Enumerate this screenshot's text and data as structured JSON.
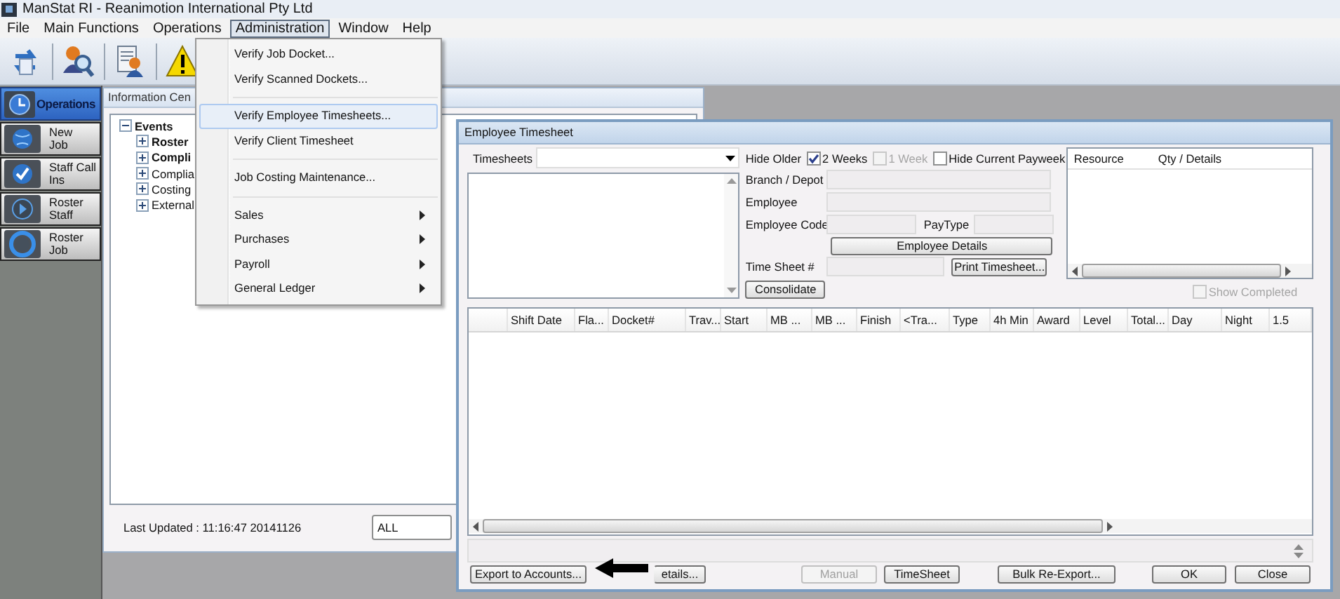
{
  "window": {
    "title": "ManStat RI - Reanimotion International Pty Ltd"
  },
  "menu_bar": [
    {
      "label": "File",
      "selected": false
    },
    {
      "label": "Main Functions",
      "selected": false
    },
    {
      "label": "Operations",
      "selected": false
    },
    {
      "label": "Administration",
      "selected": true
    },
    {
      "label": "Window",
      "selected": false
    },
    {
      "label": "Help",
      "selected": false
    }
  ],
  "admin_menu": [
    {
      "kind": "item",
      "label": "Verify Job Docket...",
      "selected": false,
      "submenu": false
    },
    {
      "kind": "item",
      "label": "Verify Scanned Dockets...",
      "selected": false,
      "submenu": false
    },
    {
      "kind": "separator"
    },
    {
      "kind": "item",
      "label": "Verify Employee Timesheets...",
      "selected": true,
      "submenu": false
    },
    {
      "kind": "item",
      "label": "Verify Client Timesheet",
      "selected": false,
      "submenu": false
    },
    {
      "kind": "separator"
    },
    {
      "kind": "item",
      "label": "Job Costing Maintenance...",
      "selected": false,
      "submenu": false
    },
    {
      "kind": "separator"
    },
    {
      "kind": "item",
      "label": "Sales",
      "selected": false,
      "submenu": true
    },
    {
      "kind": "item",
      "label": "Purchases",
      "selected": false,
      "submenu": true
    },
    {
      "kind": "item",
      "label": "Payroll",
      "selected": false,
      "submenu": true
    },
    {
      "kind": "item",
      "label": "General Ledger",
      "selected": false,
      "submenu": true
    }
  ],
  "sidebar": {
    "header": "Operations",
    "items": [
      {
        "label": "New\nJob"
      },
      {
        "label": "Staff Call\nIns"
      },
      {
        "label": "Roster\nStaff"
      },
      {
        "label": "Roster\nJob"
      }
    ]
  },
  "info_centre": {
    "title": "Information Cen",
    "tree": [
      {
        "label": "Events",
        "expanded": true,
        "emphasis": true,
        "children": [
          {
            "label": "Roster",
            "expanded": false,
            "emphasis": true
          },
          {
            "label": "Compli",
            "expanded": false,
            "emphasis": true
          },
          {
            "label": "Complia",
            "expanded": false,
            "emphasis": false
          },
          {
            "label": "Costing",
            "expanded": false,
            "emphasis": false
          },
          {
            "label": "External",
            "expanded": false,
            "emphasis": false
          }
        ]
      }
    ],
    "last_updated": "Last Updated : 11:16:47 20141126",
    "filter": "ALL"
  },
  "timesheet": {
    "title": "Employee Timesheet",
    "timesheets_label": "Timesheets",
    "hide_older_label": "Hide Older",
    "options": [
      {
        "label": "2 Weeks",
        "checked": true,
        "disabled": false
      },
      {
        "label": "1 Week",
        "checked": false,
        "disabled": true
      },
      {
        "label": "Hide Current Payweek",
        "checked": false,
        "disabled": false
      }
    ],
    "branch_label": "Branch / Depot",
    "employee_label": "Employee",
    "employee_code_label": "Employee Code",
    "paytype_label": "PayType",
    "employee_details_button": "Employee Details",
    "timesheet_no_label": "Time Sheet #",
    "print_button": "Print Timesheet...",
    "consolidate_button": "Consolidate",
    "resource_columns": [
      "Resource",
      "Qty / Details"
    ],
    "show_completed": {
      "label": "Show Completed",
      "checked": false,
      "disabled": true
    },
    "grid_columns": [
      "Shift Date",
      "Fla...",
      "Docket#",
      "Trav...",
      "Start",
      "MB ...",
      "MB ...",
      "Finish",
      "<Tra...",
      "Type",
      "4h Min",
      "Award",
      "Level",
      "Total...",
      "Day",
      "Night",
      "1.5"
    ],
    "buttons": [
      {
        "label": "Export to Accounts...",
        "disabled": false
      },
      {
        "label": "etails...",
        "disabled": false
      },
      {
        "label": "Manual",
        "disabled": true
      },
      {
        "label": "TimeSheet",
        "disabled": false
      },
      {
        "label": "Bulk Re-Export...",
        "disabled": false
      },
      {
        "label": "OK",
        "disabled": false
      },
      {
        "label": "Close",
        "disabled": false
      }
    ]
  }
}
